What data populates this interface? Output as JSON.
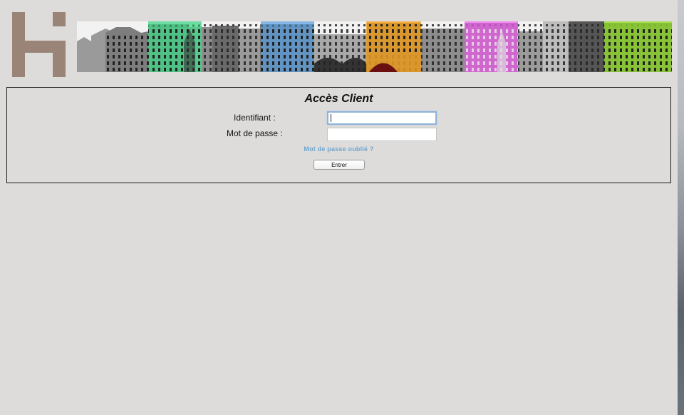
{
  "header": {
    "logo_icon": "hotel-h-logo",
    "banner_image": "paris-facades-panorama"
  },
  "login": {
    "title": "Accès Client",
    "identifier_label": "Identifiant :",
    "identifier_value": "",
    "password_label": "Mot de passe :",
    "password_value": "",
    "forgot_link": "Mot de passe oublié ?",
    "submit_label": "Entrer"
  },
  "colors": {
    "background": "#dddcdb",
    "logo": "#9a8478",
    "link": "#6ea6cf",
    "focus_ring": "#8fb3d9",
    "banner_tints": [
      "#47d88a",
      "#5aa0e0",
      "#f0a020",
      "#f060f0",
      "#8fd82a"
    ]
  }
}
